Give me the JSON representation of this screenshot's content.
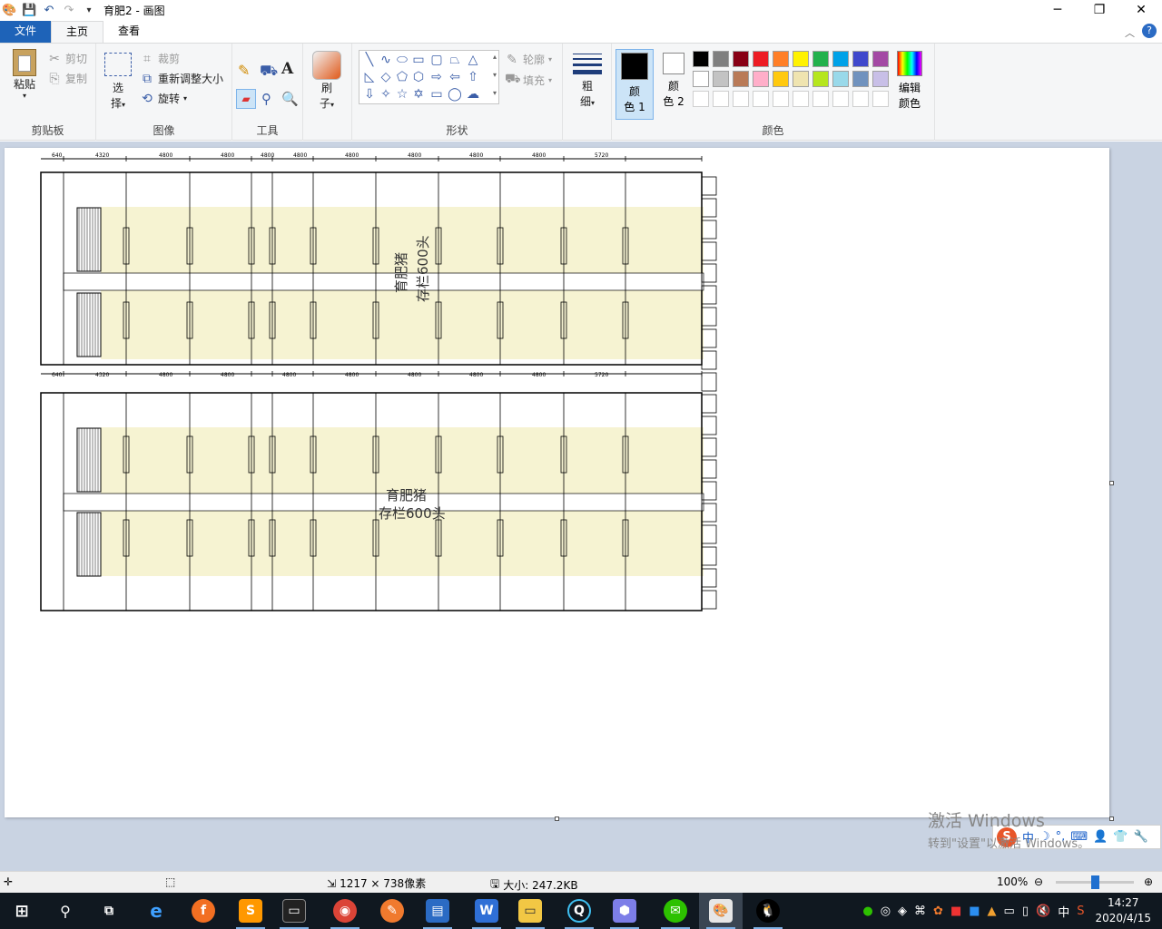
{
  "window": {
    "title": "育肥2 - 画图",
    "controls": [
      "minimize-icon",
      "restore-icon",
      "close-icon"
    ]
  },
  "tabs": [
    {
      "label": "文件"
    },
    {
      "label": "主页"
    },
    {
      "label": "查看"
    }
  ],
  "ribbon": {
    "clipboard": {
      "label": "剪贴板",
      "paste": "粘贴",
      "cut": "剪切",
      "copy": "复制"
    },
    "image": {
      "label": "图像",
      "select_1": "选",
      "select_2": "择",
      "crop": "裁剪",
      "resize": "重新调整大小",
      "rotate": "旋转"
    },
    "tools": {
      "label": "工具"
    },
    "brushes": {
      "l1": "刷",
      "l2": "子"
    },
    "shapes": {
      "label": "形状",
      "outline": "轮廓",
      "fill": "填充"
    },
    "size": {
      "l1": "粗",
      "l2": "细"
    },
    "colors": {
      "label": "颜色",
      "color1_l1": "颜",
      "color1_l2": "色 1",
      "color2_l1": "颜",
      "color2_l2": "色 2",
      "edit_l1": "编辑",
      "edit_l2": "颜色",
      "color1": "#000000",
      "color2": "#ffffff",
      "palette_row1": [
        "#000000",
        "#7f7f7f",
        "#880015",
        "#ed1c24",
        "#ff7f27",
        "#fff200",
        "#22b14c",
        "#00a2e8",
        "#3f48cc",
        "#a349a4"
      ],
      "palette_row2": [
        "#ffffff",
        "#c3c3c3",
        "#b97a57",
        "#ffaec9",
        "#ffc90e",
        "#efe4b0",
        "#b5e61d",
        "#99d9ea",
        "#7092be",
        "#c8bfe7"
      ]
    }
  },
  "drawing": {
    "dims_top": [
      "640",
      "4320",
      "4800",
      "4800",
      "4800",
      "4800",
      "4800",
      "4800",
      "4800",
      "4800",
      "5720"
    ],
    "dims_mid": [
      "640",
      "4320",
      "4800",
      "4800",
      "4800",
      "4800",
      "4800",
      "4800",
      "4800",
      "5720"
    ],
    "label_upper": "育肥猪",
    "label_upper_count": "存栏600头",
    "label_lower": "育肥猪",
    "label_lower_count": "存栏600头"
  },
  "ime": {
    "mode": "中"
  },
  "watermark": {
    "line1": "激活 Windows",
    "line2": "转到\"设置\"以激活 Windows。"
  },
  "status": {
    "image_size": "1217 × 738像素",
    "file_size": "大小: 247.2KB",
    "zoom": "100%",
    "zoom_level": 0.5
  },
  "taskbar": {
    "time": "14:27",
    "date": "2020/4/15",
    "ime": "中"
  }
}
